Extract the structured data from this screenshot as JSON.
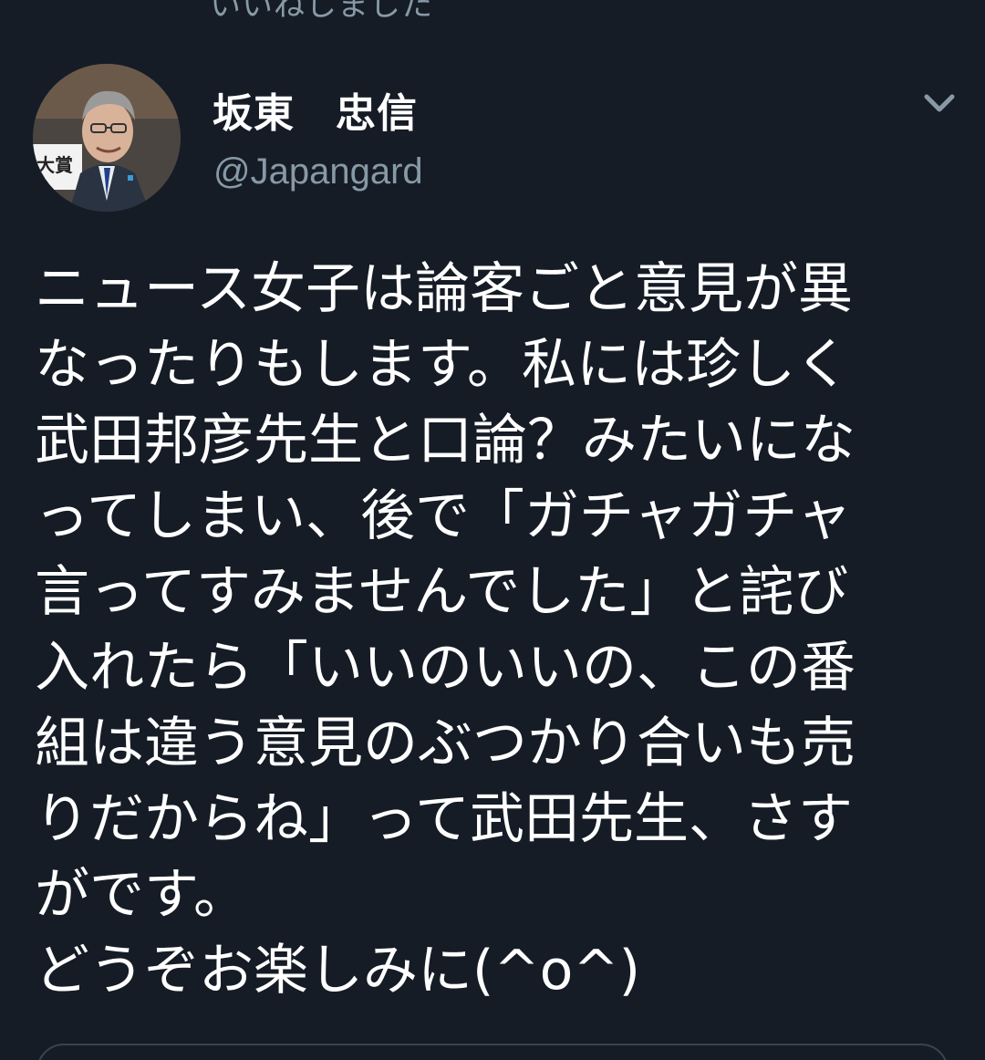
{
  "liked_banner": "いいねしました",
  "author": {
    "display_name": "坂東　忠信",
    "handle": "@Japangard",
    "avatar_text": "大賞"
  },
  "menu_icon": "chevron-down-icon",
  "tweet_lines": [
    "ニュース女子は論客ごと意見が異",
    "なったりもします。私には珍しく",
    "武田邦彦先生と口論？みたいにな",
    "ってしまい、後で「ガチャガチャ",
    "言ってすみませんでした」と詫び",
    "入れたら「いいのいいの、この番",
    "組は違う意見のぶつかり合いも売",
    "りだからね」って武田先生、さす",
    "がです。",
    "どうぞお楽しみに(^o^)"
  ],
  "colors": {
    "background": "#151c26",
    "secondary_text": "#8899a6",
    "primary_text": "#ffffff",
    "border": "#38444d"
  }
}
